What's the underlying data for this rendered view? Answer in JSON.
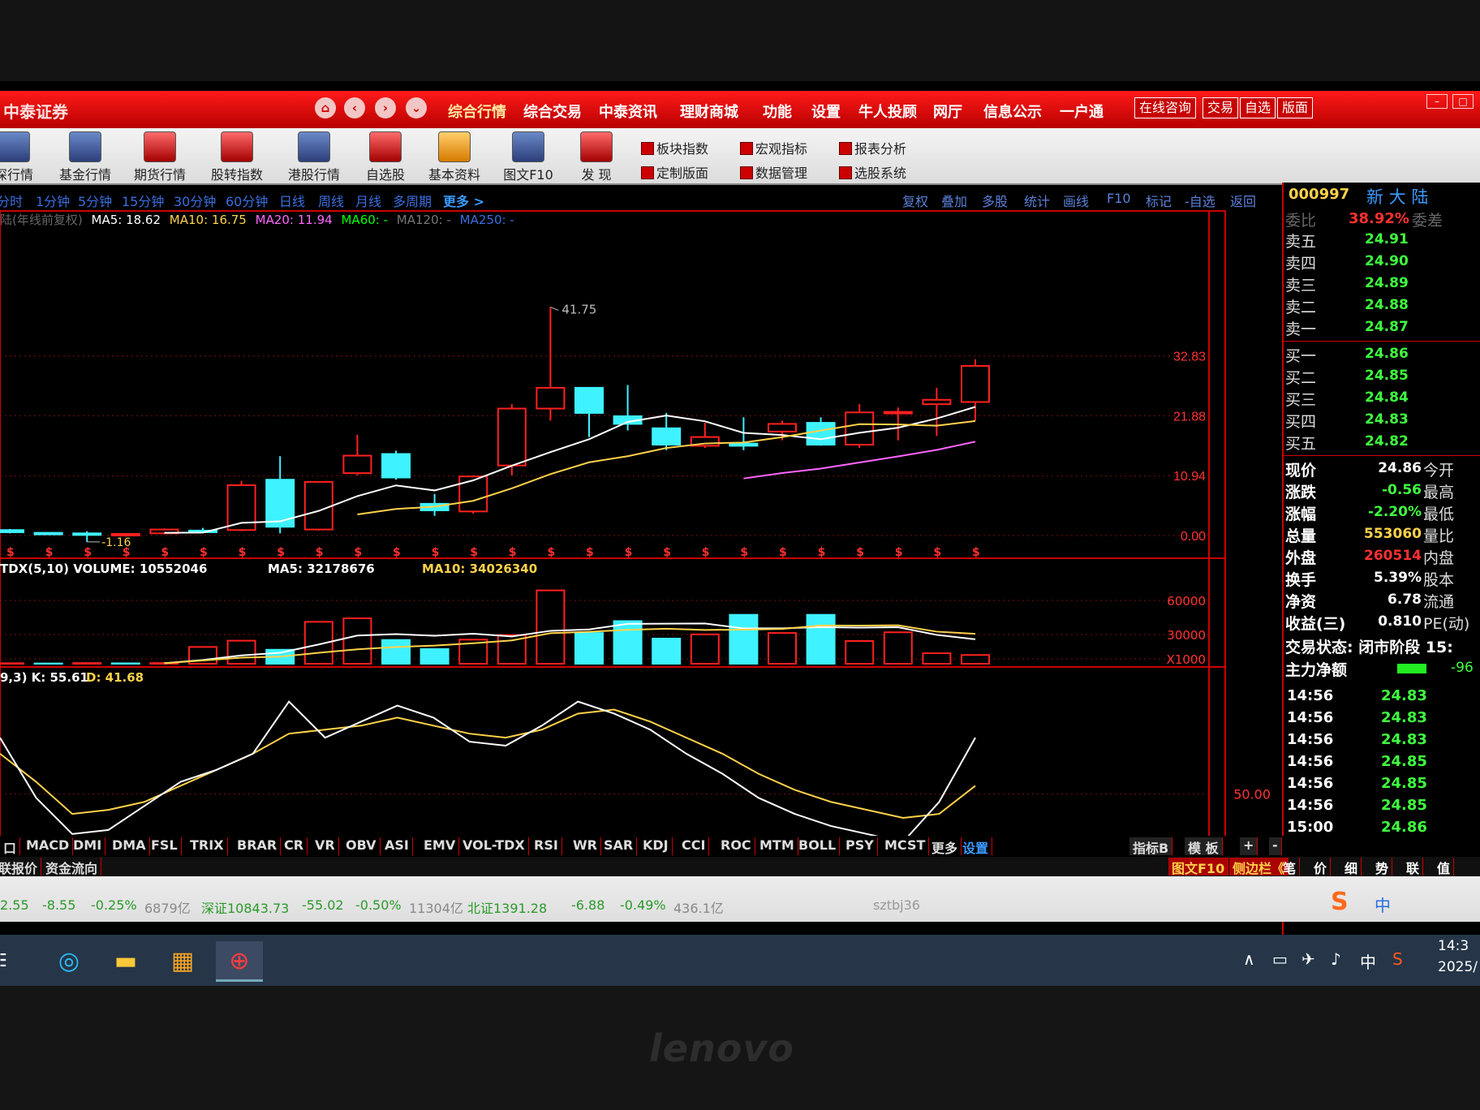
{
  "app": {
    "brand": "中泰证券",
    "menus": [
      "综合行情",
      "综合交易",
      "中泰资讯",
      "理财商城",
      "功能",
      "设置",
      "牛人投顾",
      "网厅",
      "信息公示",
      "一户通"
    ],
    "title_buttons": [
      "在线咨询",
      "交易",
      "自选",
      "版面"
    ]
  },
  "toolbar": {
    "items": [
      "深行情",
      "基金行情",
      "期货行情",
      "股转指数",
      "港股行情",
      "自选股",
      "基本资料",
      "图文F10",
      "发 现"
    ],
    "right_items": [
      "板块指数",
      "宏观指标",
      "报表分析",
      "定制版面",
      "数据管理",
      "选股系统"
    ]
  },
  "periods": {
    "items": [
      "分时",
      "1分钟",
      "5分钟",
      "15分钟",
      "30分钟",
      "60分钟",
      "日线",
      "周线",
      "月线",
      "多周期"
    ],
    "more": "更多 >",
    "right_tools": [
      "复权",
      "叠加",
      "多股",
      "统计",
      "画线",
      "F10",
      "标记",
      "-自选",
      "返回"
    ]
  },
  "ma_legend": {
    "prefix": "陆(年线前复权)",
    "ma5": "MA5: 18.62",
    "ma10": "MA10: 16.75",
    "ma20": "MA20: 11.94",
    "ma60": "MA60: -",
    "ma120": "MA120: -",
    "ma250": "MA250: -",
    "colors": {
      "ma5": "#ffffff",
      "ma10": "#ffd24a",
      "ma20": "#ff66ff",
      "ma60": "#00ff00",
      "ma120": "#777777",
      "ma250": "#3a6ee0"
    }
  },
  "chart_data": {
    "type": "candlestick",
    "price_axis_ticks": [
      "32.83",
      "21.88",
      "10.94",
      "0.00"
    ],
    "annotations": {
      "high_label": "41.75",
      "low_label": "-1.16"
    },
    "candles": [
      {
        "o": 1.0,
        "h": 1.2,
        "l": 0.4,
        "c": 0.6
      },
      {
        "o": 0.5,
        "h": 0.6,
        "l": 0.1,
        "c": 0.3
      },
      {
        "o": 0.4,
        "h": 0.8,
        "l": -1.16,
        "c": 0.2
      },
      {
        "o": 0.1,
        "h": 0.4,
        "l": -0.2,
        "c": 0.3
      },
      {
        "o": 0.4,
        "h": 1.3,
        "l": 0.2,
        "c": 1.1
      },
      {
        "o": 0.9,
        "h": 1.4,
        "l": 0.5,
        "c": 0.8
      },
      {
        "o": 1.0,
        "h": 10.0,
        "l": 0.8,
        "c": 9.2
      },
      {
        "o": 10.2,
        "h": 14.5,
        "l": 0.4,
        "c": 1.6
      },
      {
        "o": 1.1,
        "h": 9.8,
        "l": 0.9,
        "c": 9.8
      },
      {
        "o": 11.4,
        "h": 18.4,
        "l": 11.0,
        "c": 14.6
      },
      {
        "o": 14.9,
        "h": 15.5,
        "l": 10.2,
        "c": 10.6
      },
      {
        "o": 5.8,
        "h": 7.6,
        "l": 3.6,
        "c": 4.6
      },
      {
        "o": 4.4,
        "h": 10.8,
        "l": 4.0,
        "c": 10.8
      },
      {
        "o": 12.8,
        "h": 24.0,
        "l": 11.0,
        "c": 23.2
      },
      {
        "o": 23.2,
        "h": 41.75,
        "l": 21.0,
        "c": 27.0
      },
      {
        "o": 27.0,
        "h": 27.0,
        "l": 18.0,
        "c": 22.4
      },
      {
        "o": 21.8,
        "h": 27.5,
        "l": 19.2,
        "c": 20.4
      },
      {
        "o": 19.6,
        "h": 22.4,
        "l": 15.6,
        "c": 16.6
      },
      {
        "o": 16.4,
        "h": 20.6,
        "l": 16.0,
        "c": 18.0
      },
      {
        "o": 16.8,
        "h": 21.6,
        "l": 15.6,
        "c": 16.4
      },
      {
        "o": 19.0,
        "h": 21.0,
        "l": 17.4,
        "c": 20.4
      },
      {
        "o": 20.6,
        "h": 21.6,
        "l": 16.4,
        "c": 16.6
      },
      {
        "o": 16.6,
        "h": 24.0,
        "l": 16.0,
        "c": 22.5
      },
      {
        "o": 22.6,
        "h": 23.4,
        "l": 17.4,
        "c": 22.6
      },
      {
        "o": 24.0,
        "h": 27.0,
        "l": 18.2,
        "c": 24.8
      },
      {
        "o": 24.4,
        "h": 32.2,
        "l": 21.0,
        "c": 31.0
      }
    ],
    "volume": {
      "label": "TDX(5,10) VOLUME: 10552046",
      "ma5": "MA5: 32178676",
      "ma10": "MA10: 34026340",
      "axis_ticks": [
        "60000",
        "30000",
        "X1000"
      ],
      "values": [
        150,
        80,
        200,
        120,
        200,
        4800,
        6600,
        4000,
        12000,
        13000,
        6800,
        4200,
        6900,
        8200,
        21000,
        8800,
        12200,
        7200,
        8400,
        14000,
        8800,
        14000,
        6500,
        9000,
        3000,
        2500
      ],
      "up": [
        true,
        false,
        true,
        false,
        true,
        true,
        true,
        false,
        true,
        true,
        false,
        false,
        true,
        true,
        true,
        false,
        false,
        false,
        true,
        false,
        true,
        false,
        true,
        true,
        true,
        true
      ]
    },
    "kdj": {
      "label": "9,3) K: 55.61",
      "d_label": "D: 41.68",
      "axis_ticks": [
        "50.00"
      ],
      "k": [
        78,
        48,
        30,
        32,
        44,
        56,
        62,
        70,
        96,
        78,
        86,
        94,
        88,
        76,
        74,
        84,
        96,
        90,
        82,
        70,
        60,
        48,
        40,
        34,
        30,
        26,
        46,
        78
      ],
      "d": [
        70,
        56,
        40,
        42,
        46,
        54,
        62,
        70,
        80,
        82,
        84,
        88,
        84,
        80,
        78,
        82,
        90,
        92,
        86,
        78,
        70,
        60,
        52,
        46,
        42,
        38,
        40,
        54
      ]
    },
    "bottom_label": "年线"
  },
  "indicators": [
    "口",
    "MACD",
    "DMI",
    "DMA",
    "FSL",
    "TRIX",
    "BRAR",
    "CR",
    "VR",
    "OBV",
    "ASI",
    "EMV",
    "VOL-TDX",
    "RSI",
    "WR",
    "SAR",
    "KDJ",
    "CCI",
    "ROC",
    "MTM",
    "BOLL",
    "PSY",
    "MCST",
    "更多",
    "设置"
  ],
  "ind_right": [
    "指标B",
    "模 板",
    "+",
    "-"
  ],
  "bottom_left": [
    "联报价",
    "资金流向"
  ],
  "bottom_right": [
    "图文F10",
    "侧边栏《",
    "笔",
    "价",
    "细",
    "势",
    "联",
    "值"
  ],
  "quote": {
    "code": "000997",
    "name": "新 大 陆",
    "ratio_label": "委比",
    "ratio_value": "38.92%",
    "ratio_label2": "委差",
    "asks": [
      [
        "卖五",
        "24.91"
      ],
      [
        "卖四",
        "24.90"
      ],
      [
        "卖三",
        "24.89"
      ],
      [
        "卖二",
        "24.88"
      ],
      [
        "卖一",
        "24.87"
      ]
    ],
    "bids": [
      [
        "买一",
        "24.86"
      ],
      [
        "买二",
        "24.85"
      ],
      [
        "买三",
        "24.84"
      ],
      [
        "买四",
        "24.83"
      ],
      [
        "买五",
        "24.82"
      ]
    ],
    "stats": [
      [
        "现价",
        "24.86",
        "今开"
      ],
      [
        "涨跌",
        "-0.56",
        "最高"
      ],
      [
        "涨幅",
        "-2.20%",
        "最低"
      ],
      [
        "总量",
        "553060",
        "量比"
      ],
      [
        "外盘",
        "260514",
        "内盘"
      ],
      [
        "换手",
        "5.39%",
        "股本"
      ],
      [
        "净资",
        "6.78",
        "流通"
      ],
      [
        "收益(三)",
        "0.810",
        "PE(动)"
      ]
    ],
    "trade_state": "交易状态: 闭市阶段 15:",
    "main_net": "主力净额",
    "main_net_value": "-96",
    "ticks": [
      [
        "14:56",
        "24.83"
      ],
      [
        "14:56",
        "24.83"
      ],
      [
        "14:56",
        "24.83"
      ],
      [
        "14:56",
        "24.85"
      ],
      [
        "14:56",
        "24.85"
      ],
      [
        "14:56",
        "24.85"
      ],
      [
        "15:00",
        "24.86"
      ]
    ]
  },
  "status": {
    "items": [
      "2.55",
      "-8.55",
      "-0.25%",
      "6879亿",
      "深证10843.73",
      "-55.02",
      "-0.50%",
      "11304亿",
      "北证1391.28",
      "-6.88",
      "-0.49%",
      "436.1亿"
    ],
    "account": "sztbj36"
  },
  "taskbar": {
    "time": "14:3",
    "date": "2025/",
    "ime": "中"
  }
}
